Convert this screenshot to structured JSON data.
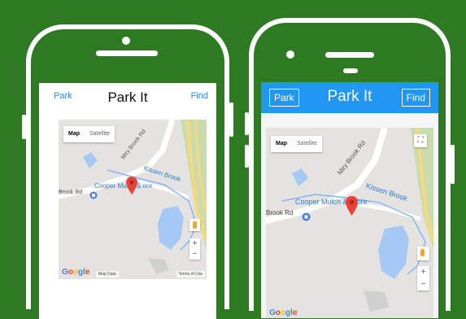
{
  "left_phone": {
    "park_link": "Park",
    "title": "Park It",
    "find_link": "Find",
    "map": {
      "tab_map": "Map",
      "tab_satellite": "Satellite",
      "label_road_1": "Miry Brook Rd",
      "label_road_2": "Brook Rd",
      "label_water": "Kissen Brook",
      "label_place": "Cooper Mulch & ore",
      "zoom_in": "+",
      "zoom_out": "−",
      "google": [
        "G",
        "o",
        "o",
        "g",
        "l",
        "e"
      ],
      "map_data": "Map Data",
      "terms": "Terms of Use"
    }
  },
  "right_phone": {
    "park_button": "Park",
    "title": "Park It",
    "find_button": "Find",
    "header_color": "#2196f3",
    "map": {
      "tab_map": "Map",
      "tab_satellite": "Satellite",
      "label_road_1": "Miry Brook Rd",
      "label_road_2": "Brook Rd",
      "label_water": "Kissen Brook",
      "label_place": "Cooper Mulch & Store",
      "zoom_in": "+",
      "zoom_out": "−",
      "google": [
        "G",
        "o",
        "o",
        "g",
        "l",
        "e"
      ]
    }
  },
  "colors": {
    "background": "#2e7a22",
    "marker": "#ea4335",
    "link": "#2a8ad8"
  },
  "icons": {
    "fullscreen": "fullscreen-icon",
    "pegman": "pegman-icon",
    "marker": "location-pin-icon"
  }
}
